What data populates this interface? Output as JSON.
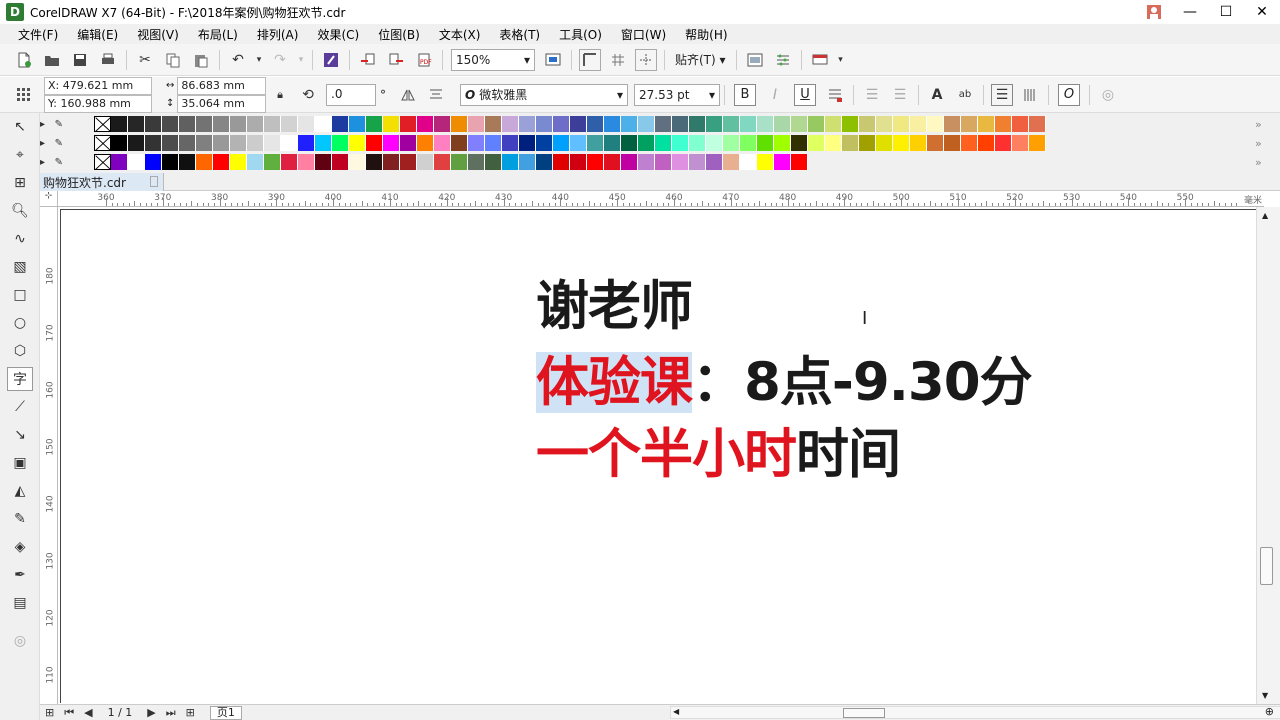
{
  "window": {
    "app_icon": "D",
    "title": "CorelDRAW X7 (64-Bit) - F:\\2018年案例\\购物狂欢节.cdr",
    "minimize": "—",
    "maximize": "☐",
    "close": "✕"
  },
  "menu": [
    "文件(F)",
    "编辑(E)",
    "视图(V)",
    "布局(L)",
    "排列(A)",
    "效果(C)",
    "位图(B)",
    "文本(X)",
    "表格(T)",
    "工具(O)",
    "窗口(W)",
    "帮助(H)"
  ],
  "toolbar": {
    "zoom": "150%",
    "snap_label": "贴齐(T)"
  },
  "property_bar": {
    "x": "X: 479.621 mm",
    "y": "Y: 160.988 mm",
    "width": "86.683 mm",
    "height": "35.064 mm",
    "rotation": ".0",
    "degree_sign": "°",
    "font": "微软雅黑",
    "font_size": "27.53 pt",
    "bold_btn": "B",
    "underline_btn": "U"
  },
  "palette": {
    "row1": [
      "#1a1a1a",
      "#262626",
      "#3a3a3a",
      "#4d4d4d",
      "#606060",
      "#737373",
      "#868686",
      "#999999",
      "#acacac",
      "#bfbfbf",
      "#d2d2d2",
      "#e5e5e5",
      "#ffffff",
      "#1e3ca0",
      "#1e90e0",
      "#16a34a",
      "#f4e000",
      "#e11d26",
      "#e0008a",
      "#b5267a",
      "#f08c00",
      "#e8a2b0",
      "#a87a5a",
      "#c8a8d8",
      "#9aa0d8",
      "#7a8ad0",
      "#6e6ec8",
      "#3d3d9a",
      "#2f5fa8",
      "#2a8ae0",
      "#4db0e8",
      "#88c8e8",
      "#607080",
      "#4a6a7a",
      "#2f7a6a",
      "#38a080",
      "#60c0a0",
      "#80d8c0",
      "#a8e0c8",
      "#a8d8a8",
      "#b0d890",
      "#98c860",
      "#d0e070",
      "#8cc000",
      "#c8c870",
      "#e0e090",
      "#f0e880",
      "#f8f0a0",
      "#fff8c0",
      "#c89060",
      "#d8a860",
      "#e8b840",
      "#f08030",
      "#f06040",
      "#e07050"
    ],
    "row2": [
      "#000000",
      "#1a1a1a",
      "#333333",
      "#4d4d4d",
      "#666666",
      "#808080",
      "#999999",
      "#b3b3b3",
      "#cccccc",
      "#e6e6e6",
      "#ffffff",
      "#2020ff",
      "#00c8ff",
      "#00ff60",
      "#ffff00",
      "#ff0000",
      "#ff00ff",
      "#a000a0",
      "#ff8000",
      "#ff80c0",
      "#804020",
      "#8080ff",
      "#6080ff",
      "#4040c0",
      "#002080",
      "#0040a0",
      "#00a0ff",
      "#60c0ff",
      "#40a0a0",
      "#208080",
      "#006040",
      "#00a060",
      "#00e0a0",
      "#40ffd0",
      "#80ffd0",
      "#c0ffe0",
      "#a0ffa0",
      "#80ff60",
      "#60e000",
      "#a0ff00",
      "#303000",
      "#e0ff60",
      "#ffff80",
      "#c0c060",
      "#a0a000",
      "#e0e000",
      "#fff000",
      "#ffd000",
      "#d07030",
      "#c06020",
      "#ff6020",
      "#ff4000",
      "#ff3030",
      "#ff8060",
      "#ffa000"
    ],
    "row3": [
      "#8000c0",
      "#ffffff",
      "#0000ff",
      "#000000",
      "#101010",
      "#ff6600",
      "#ff0000",
      "#ffff00",
      "#a0d8f0",
      "#60b040",
      "#e02040",
      "#ff80a0",
      "#600010",
      "#c00020",
      "#fff8e0",
      "#201010",
      "#802020",
      "#a02020",
      "#d0d0d0",
      "#e04040",
      "#60a040",
      "#607060",
      "#406040",
      "#00a0e0",
      "#40a0e0",
      "#004080",
      "#e00000",
      "#d00010",
      "#ff0000",
      "#e01020",
      "#c000a0",
      "#c080d0",
      "#c060c0",
      "#e090e0",
      "#c090d0",
      "#a060c0",
      "#e8b090",
      "#ffffff",
      "#ffff00",
      "#ff00ff",
      "#ff0000"
    ],
    "more": "»"
  },
  "document_tab": "购物狂欢节.cdr",
  "ruler": {
    "unit": "毫米",
    "top_ticks": [
      "360",
      "370",
      "380",
      "390",
      "400",
      "410",
      "420",
      "430",
      "440",
      "450",
      "460",
      "470",
      "480",
      "490",
      "500",
      "510",
      "520",
      "530",
      "540",
      "550"
    ],
    "left_ticks": [
      "180",
      "170",
      "160",
      "150",
      "140",
      "130",
      "120",
      "110"
    ]
  },
  "canvas_text": {
    "line1": "谢老师",
    "line2_sel": "体验课",
    "line2_rest": "：8点-9.30分",
    "line3_red": "一个半小时",
    "line3_black": "时间"
  },
  "statusbar": {
    "page_count": "1 / 1",
    "page_tab": "页1"
  }
}
